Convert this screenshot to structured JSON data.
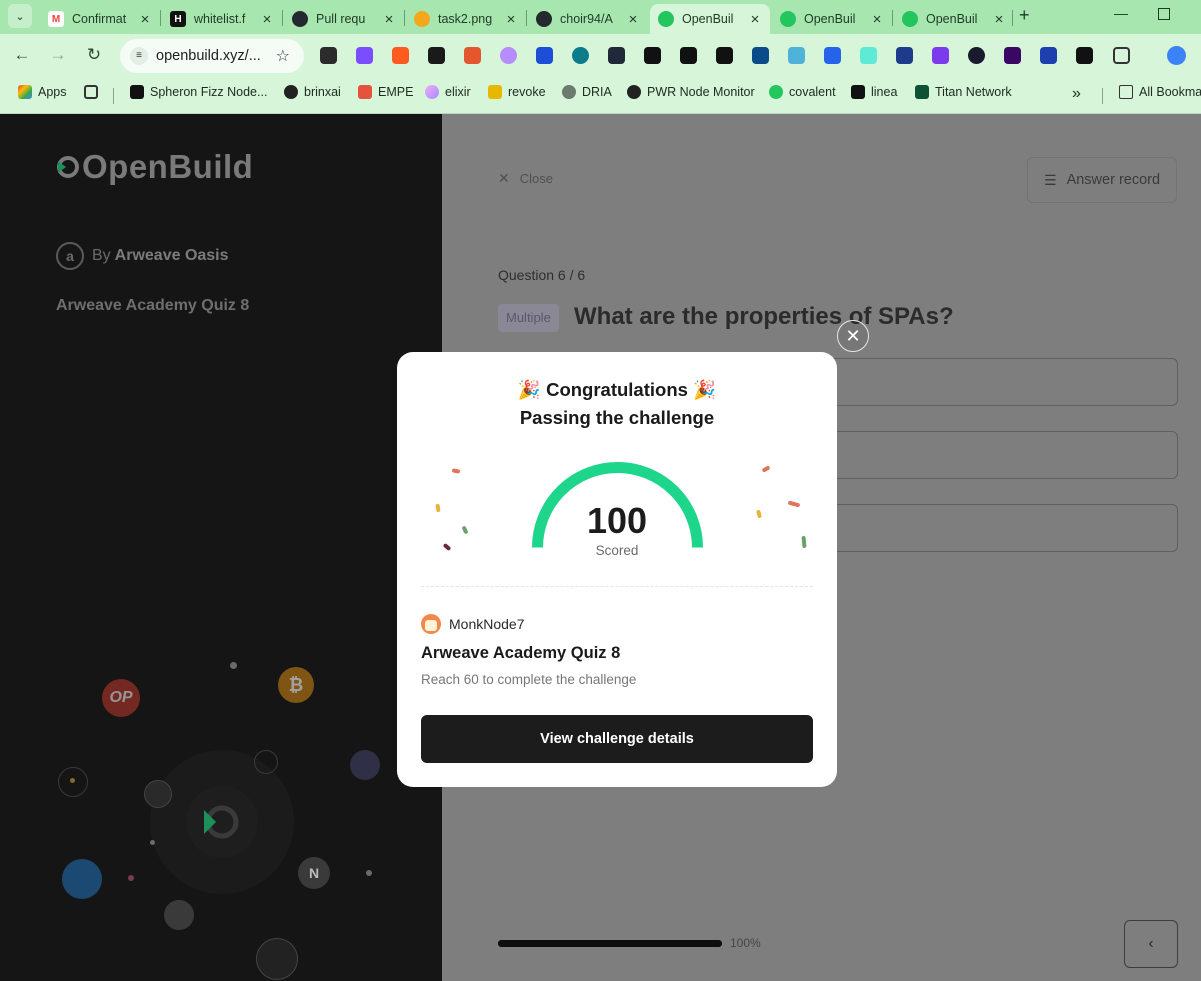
{
  "browser": {
    "tabs": [
      {
        "title": "Confirmat",
        "favicon_color": "#ea4335",
        "active": false
      },
      {
        "title": "whitelist.f",
        "favicon_color": "#111111",
        "active": false
      },
      {
        "title": "Pull requ",
        "favicon_color": "#24292f",
        "active": false
      },
      {
        "title": "task2.png",
        "favicon_color": "#f4a61c",
        "active": false
      },
      {
        "title": "choir94/A",
        "favicon_color": "#24292f",
        "active": false
      },
      {
        "title": "OpenBuil",
        "favicon_color": "#22c55e",
        "active": true
      },
      {
        "title": "OpenBuil",
        "favicon_color": "#22c55e",
        "active": false
      },
      {
        "title": "OpenBuil",
        "favicon_color": "#22c55e",
        "active": false
      }
    ],
    "url": "openbuild.xyz/...",
    "bookmarks": [
      {
        "label": "Apps"
      },
      {
        "label": "Spheron Fizz Node..."
      },
      {
        "label": "brinxai"
      },
      {
        "label": "EMPE"
      },
      {
        "label": "elixir"
      },
      {
        "label": "revoke"
      },
      {
        "label": "DRIA"
      },
      {
        "label": "PWR Node Monitor"
      },
      {
        "label": "covalent"
      },
      {
        "label": "linea"
      },
      {
        "label": "Titan Network"
      },
      {
        "label": "All Bookmarks"
      }
    ]
  },
  "left": {
    "logo_text": "OpenBuild",
    "by_prefix": "By",
    "org": "Arweave Oasis",
    "quiz_title": "Arweave Academy Quiz 8",
    "coins": [
      "OP",
      "₿",
      "N"
    ]
  },
  "right": {
    "close_label": "Close",
    "answer_record_label": "Answer record",
    "question_number": "Question 6 / 6",
    "question_type": "Multiple",
    "question_text": "What are the properties of SPAs?",
    "progress_percent": 100,
    "progress_label": "100%"
  },
  "modal": {
    "title_line1": "🎉 Congratulations 🎉",
    "title_line2": "Passing the challenge",
    "score": "100",
    "score_caption": "Scored",
    "score_fraction": 1.0,
    "username": "MonkNode7",
    "quiz_title": "Arweave Academy Quiz 8",
    "requirement": "Reach 60 to complete the challenge",
    "button_label": "View challenge details",
    "gauge_color": "#1ed68b"
  }
}
